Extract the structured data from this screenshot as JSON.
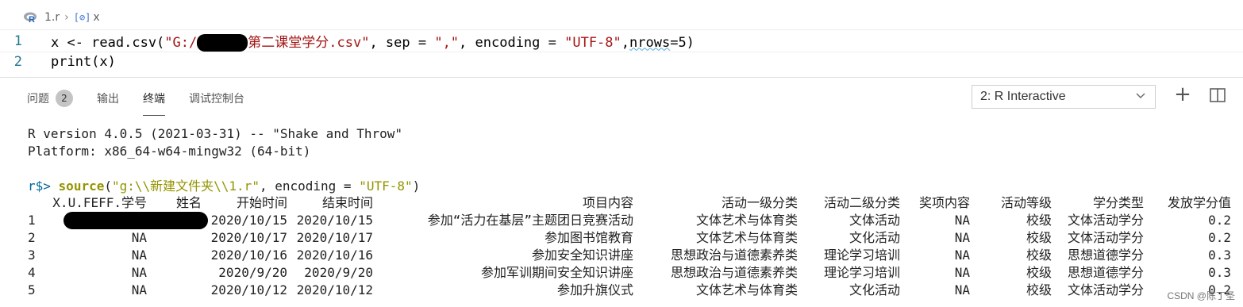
{
  "editor": {
    "breadcrumb": {
      "file": "1.r",
      "symbol": "x"
    },
    "lines": [
      {
        "num": "1",
        "pre": "x <- read.csv(",
        "str1a": "\"G:/",
        "str1b": "第二课堂学分.csv\"",
        "mid1": ", sep = ",
        "str2": "\",\"",
        "mid2": ", encoding = ",
        "str3": "\"UTF-8\"",
        "mid3": ",",
        "sq": "nrows",
        "post": "=5)"
      },
      {
        "num": "2",
        "text": "print(x)"
      }
    ]
  },
  "panel": {
    "tabs": [
      {
        "label": "问题",
        "badge": "2"
      },
      {
        "label": "输出"
      },
      {
        "label": "终端"
      },
      {
        "label": "调试控制台"
      }
    ],
    "terminal_select": "2: R Interactive",
    "icons": {
      "chevron": "chevron-down-icon",
      "plus": "plus-icon",
      "split": "split-editor-icon"
    }
  },
  "terminal": {
    "version": "R version 4.0.5 (2021-03-31) -- \"Shake and Throw\"",
    "platform": "Platform: x86_64-w64-mingw32 (64-bit)",
    "prompt": "r$>",
    "cmd_fn": "source",
    "cmd_open": "(",
    "cmd_path": "\"g:\\\\新建文件夹\\\\1.r\"",
    "cmd_mid": ", encoding = ",
    "cmd_enc": "\"UTF-8\"",
    "cmd_close": ")",
    "headers": [
      "X.U.FEFF.学号",
      "姓名",
      "开始时间",
      "结束时间",
      "项目内容",
      "活动一级分类",
      "活动二级分类",
      "奖项内容",
      "活动等级",
      "学分类型",
      "发放学分值"
    ],
    "rows": [
      [
        "1",
        "",
        "",
        "2020/10/15",
        "2020/10/15",
        "参加“活力在基层”主题团日竞赛活动",
        "文体艺术与体育类",
        "文体活动",
        "NA",
        "校级",
        "文体活动学分",
        "0.2"
      ],
      [
        "2",
        "",
        "NA",
        "2020/10/17",
        "2020/10/17",
        "参加图书馆教育",
        "文体艺术与体育类",
        "文化活动",
        "NA",
        "校级",
        "文体活动学分",
        "0.2"
      ],
      [
        "3",
        "",
        "NA",
        "2020/10/16",
        "2020/10/16",
        "参加安全知识讲座",
        "思想政治与道德素养类",
        "理论学习培训",
        "NA",
        "校级",
        "思想道德学分",
        "0.3"
      ],
      [
        "4",
        "",
        "NA",
        "2020/9/20",
        "2020/9/20",
        "参加军训期间安全知识讲座",
        "思想政治与道德素养类",
        "理论学习培训",
        "NA",
        "校级",
        "思想道德学分",
        "0.3"
      ],
      [
        "5",
        "",
        "NA",
        "2020/10/12",
        "2020/10/12",
        "参加升旗仪式",
        "文体艺术与体育类",
        "文化活动",
        "NA",
        "校级",
        "文体活动学分",
        "0.2"
      ]
    ]
  },
  "watermark": "CSDN @陈丁圣"
}
